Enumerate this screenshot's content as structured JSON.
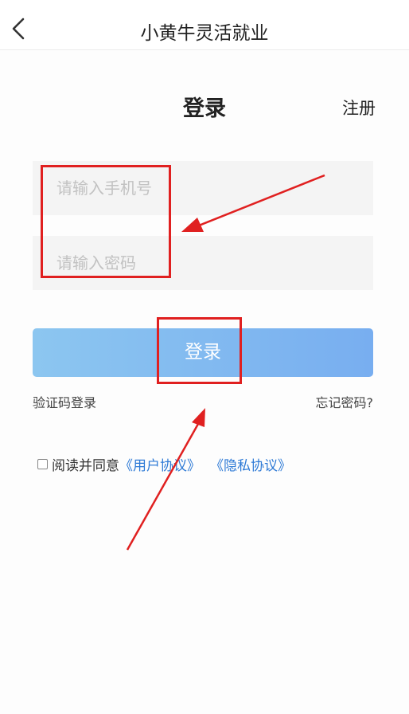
{
  "header": {
    "title": "小黄牛灵活就业"
  },
  "login": {
    "heading": "登录",
    "register": "注册",
    "phone_placeholder": "请输入手机号",
    "password_placeholder": "请输入密码",
    "submit": "登录",
    "sms_login": "验证码登录",
    "forgot_password": "忘记密码?"
  },
  "agreement": {
    "prefix": "阅读并同意",
    "user_agreement": "《用户协议》",
    "privacy_policy": "《隐私协议》",
    "checked": false
  },
  "colors": {
    "button_start": "#8cc6f0",
    "button_end": "#78aef0",
    "link": "#2e7ad6",
    "annotation": "#e02020"
  }
}
